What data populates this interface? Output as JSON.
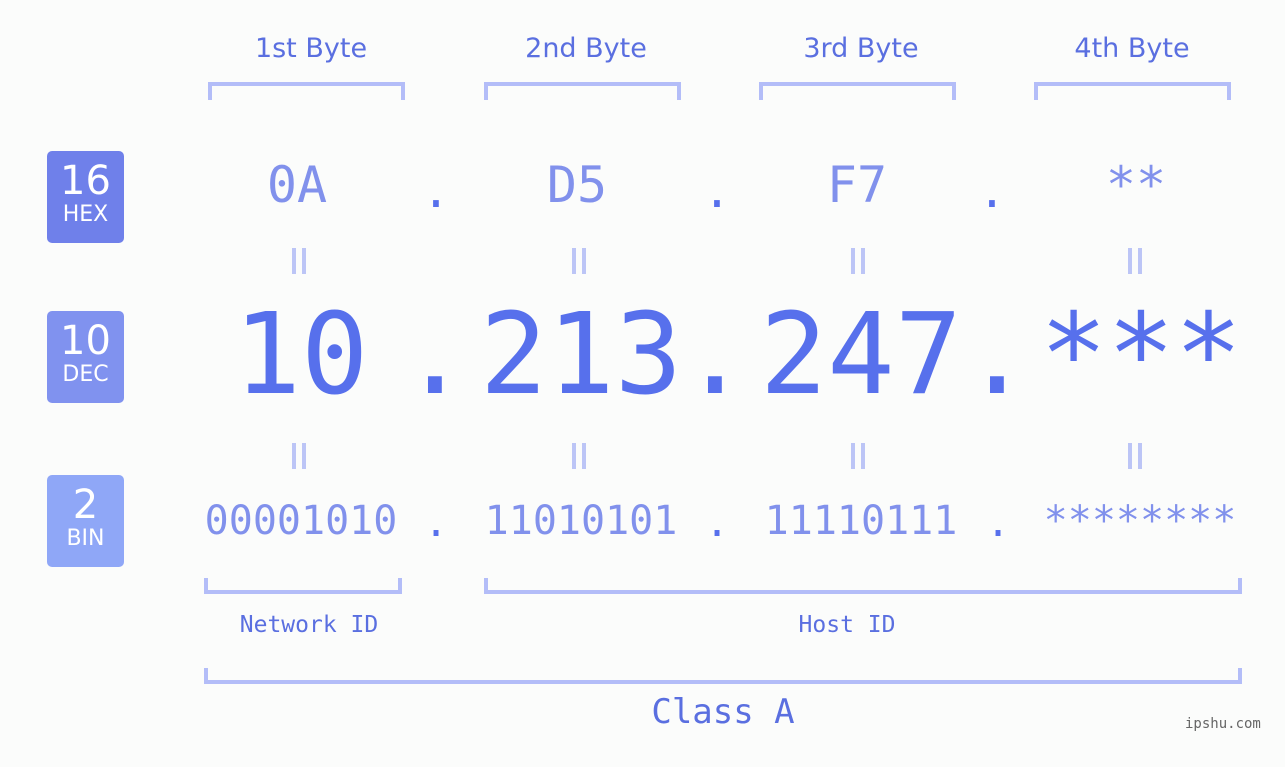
{
  "byte_headers": [
    "1st Byte",
    "2nd Byte",
    "3rd Byte",
    "4th Byte"
  ],
  "badges": {
    "hex": {
      "num": "16",
      "label": "HEX",
      "color": "#6f80ea"
    },
    "dec": {
      "num": "10",
      "label": "DEC",
      "color": "#8092ef"
    },
    "bin": {
      "num": "2",
      "label": "BIN",
      "color": "#8fa7f7"
    }
  },
  "hex": [
    "0A",
    "D5",
    "F7",
    "**"
  ],
  "dec": [
    "10",
    "213",
    "247",
    "***"
  ],
  "bin": [
    "00001010",
    "11010101",
    "11110111",
    "********"
  ],
  "separator": ".",
  "equals_symbol": "=",
  "network_id_label": "Network ID",
  "host_id_label": "Host ID",
  "class_label": "Class A",
  "watermark": "ipshu.com",
  "colors": {
    "accent": "#5770ec",
    "light_accent": "#8191ec",
    "bracket": "#b3bdf8",
    "background": "#fbfcfb"
  }
}
